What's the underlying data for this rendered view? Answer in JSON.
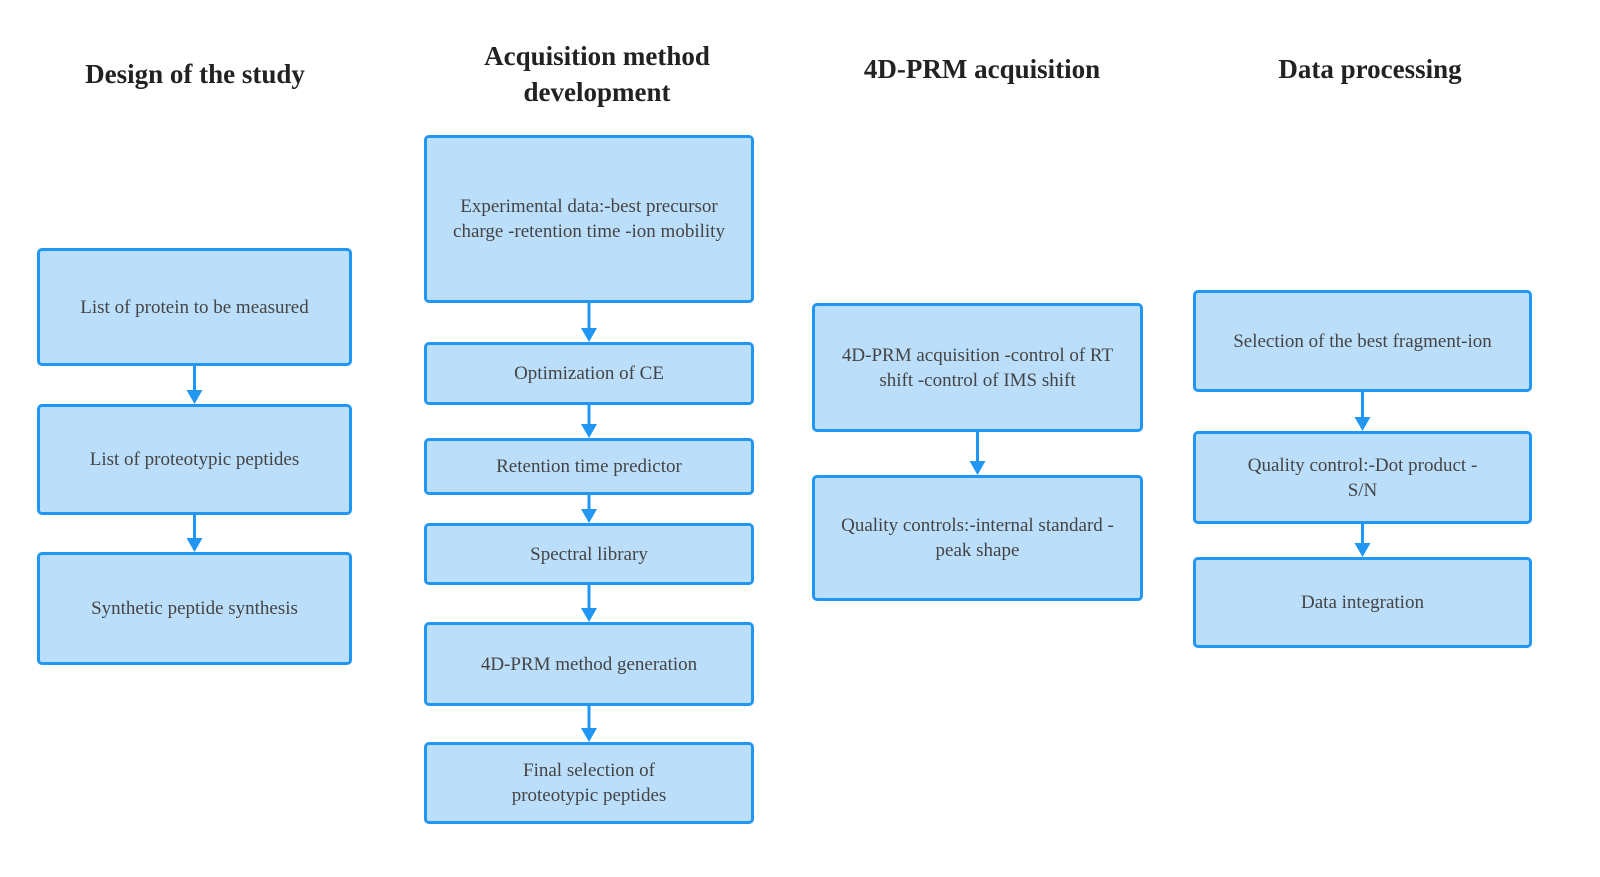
{
  "columns": [
    {
      "title": "Design of the study",
      "boxes": [
        "List of protein to be measured",
        "List of proteotypic peptides",
        "Synthetic peptide synthesis"
      ]
    },
    {
      "title": "Acquisition method development",
      "boxes": [
        "Experimental data:-best precursor charge -retention time -ion mobility",
        "Optimization of CE",
        "Retention time predictor",
        "Spectral library",
        "4D-PRM method generation",
        "Final selection of proteotypic peptides"
      ]
    },
    {
      "title": "4D-PRM acquisition",
      "boxes": [
        "4D-PRM acquisition -control of RT shift -control of IMS shift",
        "Quality controls:-internal standard - peak shape"
      ]
    },
    {
      "title": "Data processing",
      "boxes": [
        "Selection of the best fragment-ion",
        "Quality control:-Dot product -S/N",
        "Data integration"
      ]
    }
  ],
  "colors": {
    "box_fill": "#bbdefb",
    "box_border": "#2196f3",
    "arrow": "#2196f3"
  }
}
